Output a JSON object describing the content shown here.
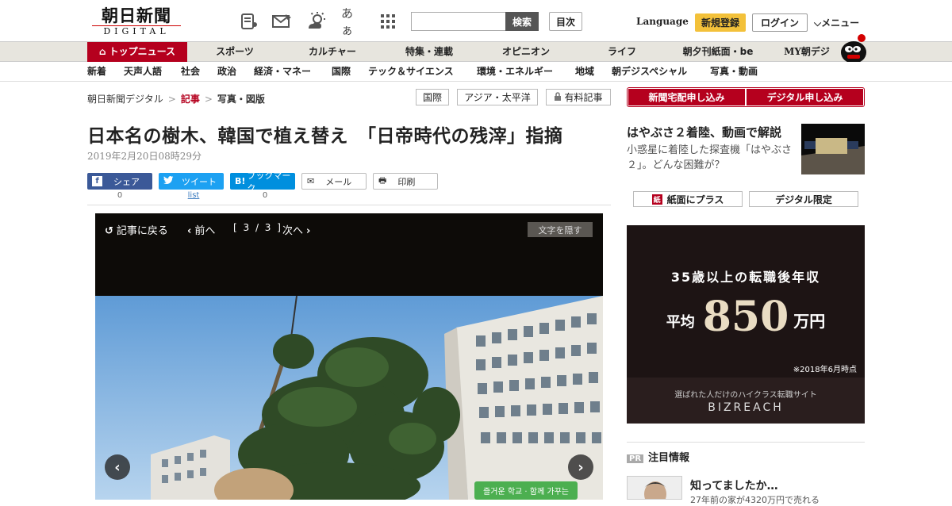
{
  "header": {
    "logo_main": "朝日新聞",
    "logo_sub": "DIGITAL",
    "search_button": "検索",
    "index_button": "目次",
    "language": "Language",
    "signup": "新規登録",
    "login": "ログイン",
    "menu": "メニュー",
    "icons": [
      "newspaper-icon",
      "mail-icon",
      "weather-icon",
      "font-size-icon",
      "grid-icon"
    ],
    "font_icon_text": "あぁ"
  },
  "nav_primary": [
    {
      "label": "トップニュース",
      "active": true
    },
    {
      "label": "スポーツ"
    },
    {
      "label": "カルチャー"
    },
    {
      "label": "特集・連載"
    },
    {
      "label": "オピニオン"
    },
    {
      "label": "ライフ"
    },
    {
      "label": "朝夕刊紙面・be"
    },
    {
      "label": "MY朝デジ"
    }
  ],
  "nav_secondary": [
    "新着",
    "天声人語",
    "社会",
    "政治",
    "経済・マネー",
    "国際",
    "テック＆サイエンス",
    "環境・エネルギー",
    "地域",
    "朝デジスペシャル",
    "写真・動画"
  ],
  "breadcrumb": {
    "home": "朝日新聞デジタル",
    "current": "記事",
    "last": "写真・図版",
    "sep": ">"
  },
  "tags": {
    "international": "国際",
    "asia": "アジア・太平洋",
    "paid": "有料記事"
  },
  "article": {
    "title": "日本名の樹木、韓国で植え替え　「日帝時代の残滓」指摘",
    "date": "2019年2月20日08時29分"
  },
  "share": {
    "facebook": "シェア",
    "facebook_count": "0",
    "twitter": "ツイート",
    "twitter_count": "list",
    "hatena": "ブックマーク",
    "hatena_count": "0",
    "mail": "メール",
    "print": "印刷"
  },
  "viewer": {
    "back": "記事に戻る",
    "prev": "前へ",
    "page": "[ 3 / 3 ]",
    "next": "次へ",
    "hide_text": "文字を隠す",
    "sign_text": "즐거운 학교 · 함께 가꾸는"
  },
  "sidebar": {
    "home_delivery": "新聞宅配申し込み",
    "digital_apply": "デジタル申し込み",
    "news_title": "はやぶさ２着陸、動画で解説",
    "news_desc": "小惑星に着陸した探査機「はやぶさ２」。どんな困難が？",
    "paper_plus": "紙面にプラス",
    "digital_only": "デジタル限定",
    "ad_line1": "35歳以上の転職後年収",
    "ad_prefix": "平均",
    "ad_number": "850",
    "ad_unit": "万円",
    "ad_note": "※2018年6月時点",
    "ad_sub": "選ばれた人だけのハイクラス転職サイト",
    "ad_brand": "BIZREACH",
    "pr_badge": "PR",
    "pr_title": "注目情報",
    "pr_headline": "知ってましたか…",
    "pr_desc": "27年前の家が4320万円で売れる"
  },
  "colors": {
    "brand_red": "#b5001e",
    "signup_yellow": "#f3c13a",
    "facebook": "#3b5998",
    "twitter": "#1da1f2",
    "hatena": "#008fde"
  }
}
